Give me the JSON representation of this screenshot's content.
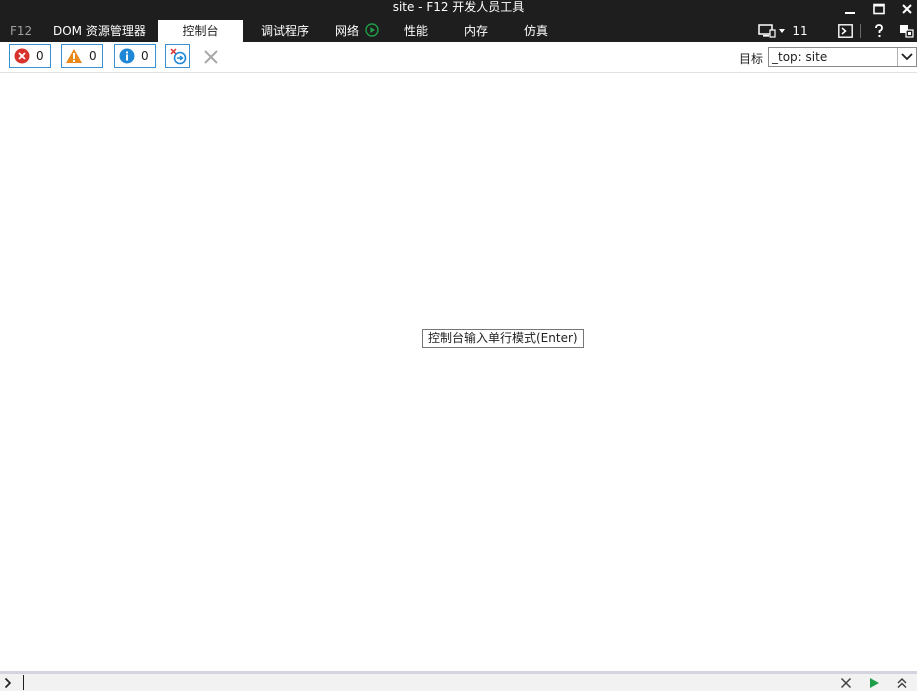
{
  "window": {
    "title": "site - F12 开发人员工具"
  },
  "tabs": {
    "f12": "F12",
    "dom_explorer": "DOM 资源管理器",
    "console": "控制台",
    "debugger": "调试程序",
    "network": "网络",
    "performance": "性能",
    "memory": "内存",
    "emulation": "仿真"
  },
  "right_controls": {
    "document_mode": "11"
  },
  "toolbar": {
    "error_count": "0",
    "warning_count": "0",
    "info_count": "0",
    "target_label": "目标",
    "target_value": "_top: site"
  },
  "console": {
    "tooltip": "控制台输入单行模式(Enter)"
  },
  "colors": {
    "chrome_dark": "#1e1e1e",
    "accent_blue": "#3c8fd0",
    "error_red": "#d9312b",
    "warning_orange": "#e8891a",
    "info_blue": "#1e88d6",
    "run_green": "#1e9e48"
  },
  "icons": {
    "error": "error-icon",
    "warning": "warning-icon",
    "info": "info-icon",
    "clear_on_navigate": "clear-on-navigate-icon",
    "clear": "clear-icon",
    "minimize": "minimize-icon",
    "maximize": "maximize-icon",
    "close": "close-icon",
    "play": "network-play-icon",
    "monitor": "monitor-icon",
    "console_toggle": "console-toggle-icon",
    "help": "help-icon",
    "undock": "undock-icon",
    "prompt": "chevron-right-icon",
    "clear_input": "clear-input-icon",
    "run": "run-icon",
    "expand": "expand-icon"
  }
}
